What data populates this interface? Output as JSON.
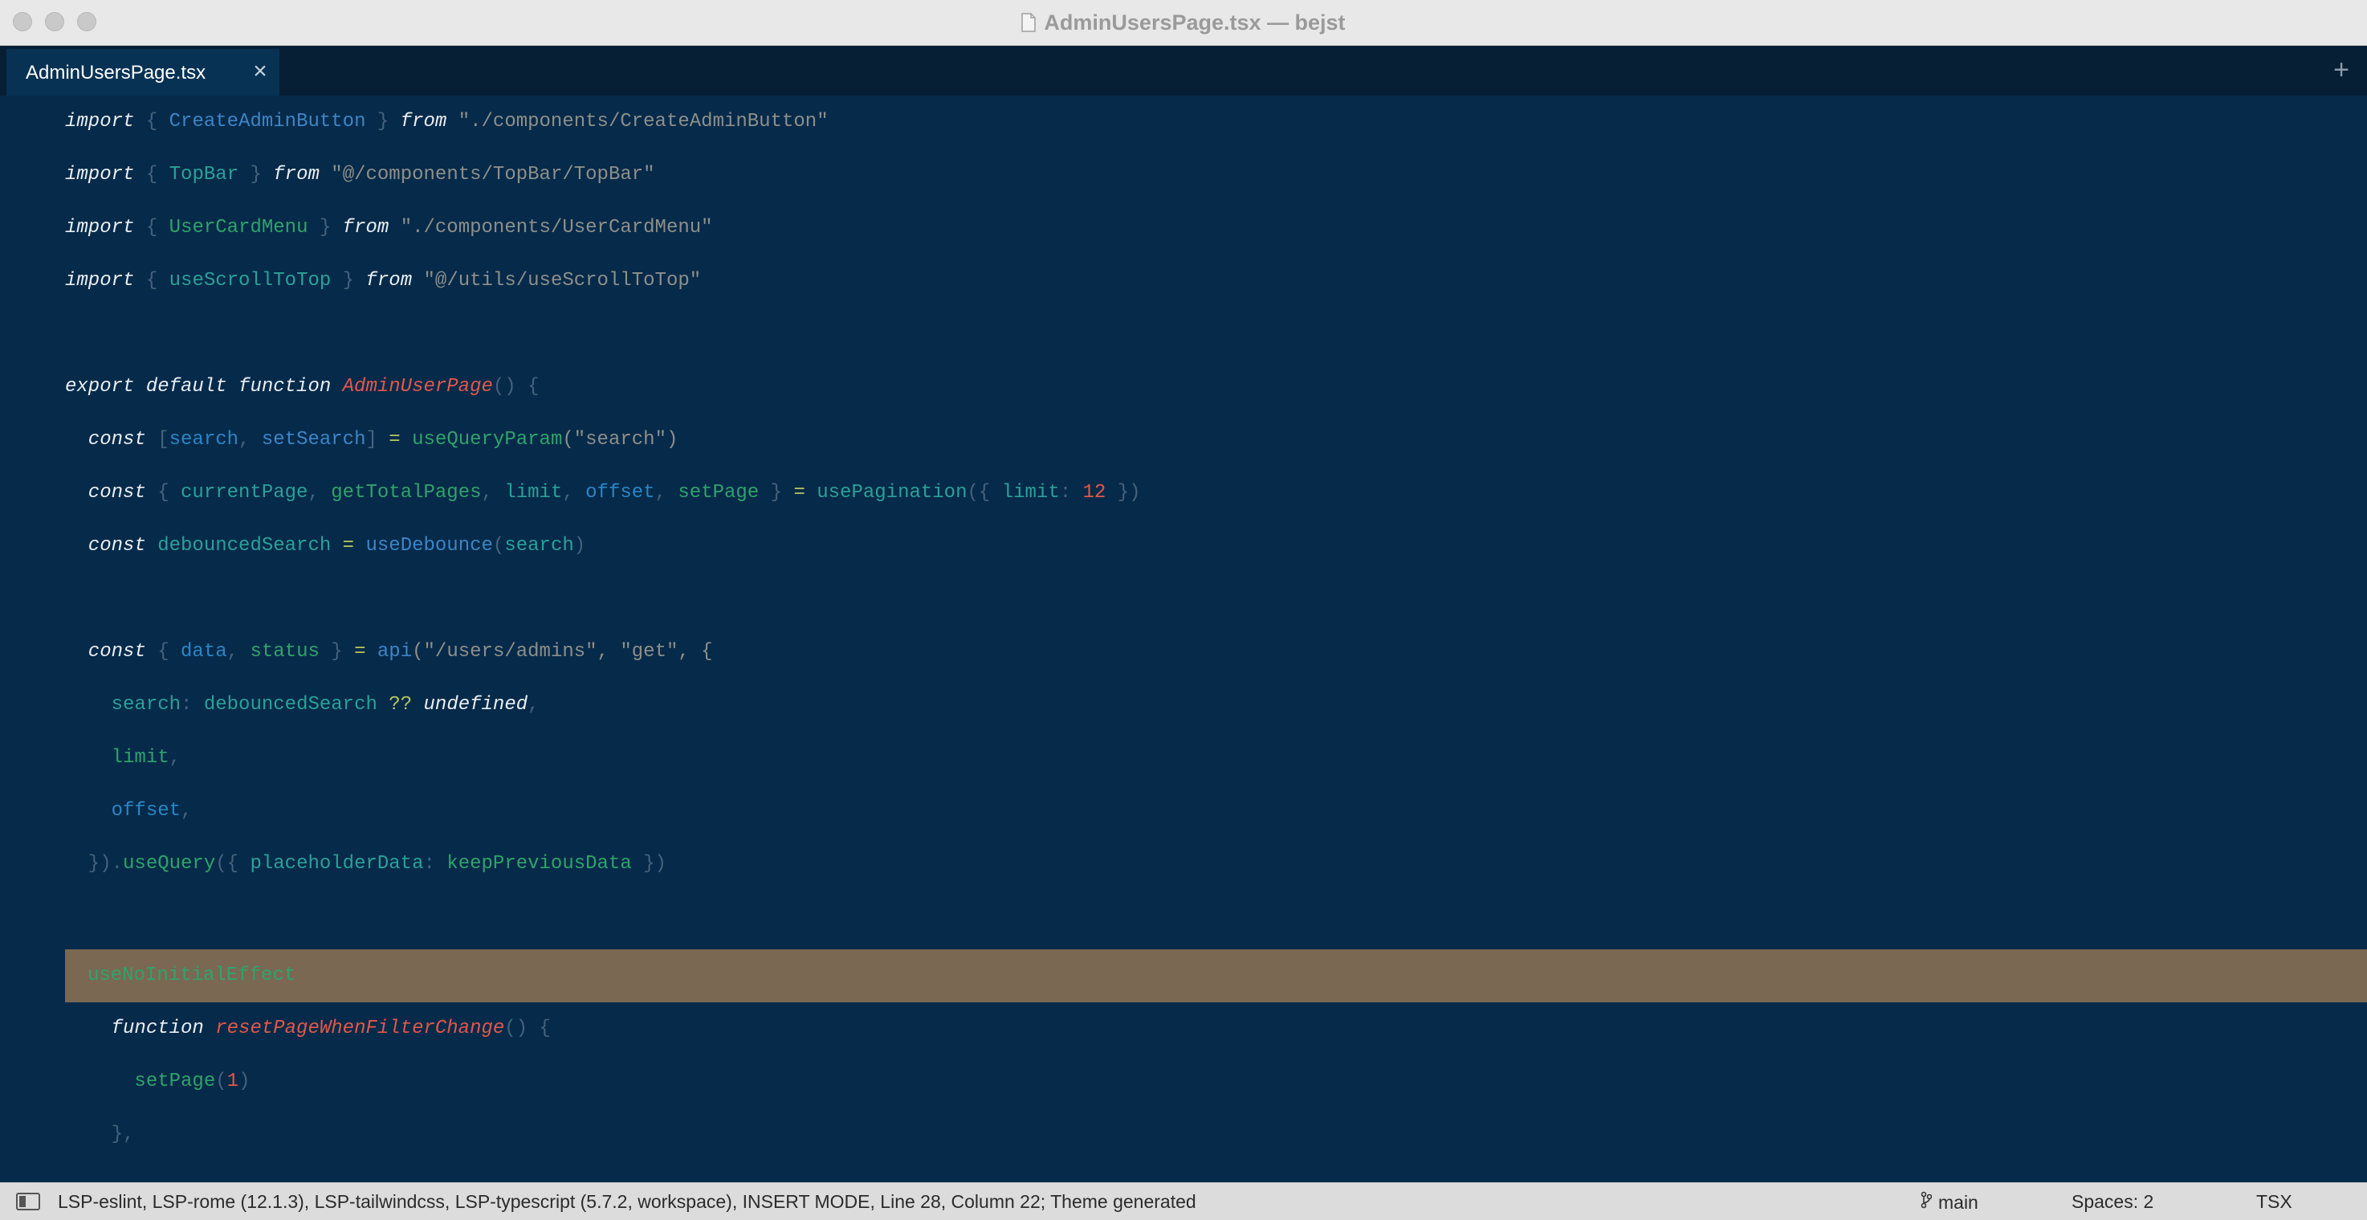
{
  "window": {
    "title": "AdminUsersPage.tsx — bejst"
  },
  "tabs": [
    {
      "label": "AdminUsersPage.tsx",
      "close": "×"
    }
  ],
  "new_tab": "+",
  "code": {
    "l1": {
      "a": "import",
      "b": " { ",
      "c": "CreateAdminButton",
      "d": " } ",
      "e": "from",
      "f": " \"./components/CreateAdminButton\""
    },
    "l2": {
      "a": "import",
      "b": " { ",
      "c": "TopBar",
      "d": " } ",
      "e": "from",
      "f": " \"@/components/TopBar/TopBar\""
    },
    "l3": {
      "a": "import",
      "b": " { ",
      "c": "UserCardMenu",
      "d": " } ",
      "e": "from",
      "f": " \"./components/UserCardMenu\""
    },
    "l4": {
      "a": "import",
      "b": " { ",
      "c": "useScrollToTop",
      "d": " } ",
      "e": "from",
      "f": " \"@/utils/useScrollToTop\""
    },
    "l6": {
      "a": "export default function ",
      "b": "AdminUserPage",
      "c": "() {"
    },
    "l7": {
      "a": "  const ",
      "b": "[",
      "c": "search",
      "d": ", ",
      "e": "setSearch",
      "f": "] ",
      "g": "=",
      "h": " ",
      "i": "useQueryParam",
      "j": "(\"search\")"
    },
    "l8": {
      "a": "  const ",
      "b": "{ ",
      "c": "currentPage",
      "d": ", ",
      "e": "getTotalPages",
      "f": ", ",
      "g": "limit",
      "h": ", ",
      "i": "offset",
      "j": ", ",
      "k": "setPage",
      "l": " } ",
      "m": "=",
      "n": " ",
      "o": "usePagination",
      "p": "({ ",
      "q": "limit",
      "r": ": ",
      "s": "12",
      "t": " })"
    },
    "l9": {
      "a": "  const ",
      "b": "debouncedSearch",
      "c": " ",
      "d": "=",
      "e": " ",
      "f": "useDebounce",
      "g": "(",
      "h": "search",
      "i": ")"
    },
    "l11": {
      "a": "  const ",
      "b": "{ ",
      "c": "data",
      "d": ", ",
      "e": "status",
      "f": " } ",
      "g": "=",
      "h": " ",
      "i": "api",
      "j": "(\"/users/admins\", \"get\", {"
    },
    "l12": {
      "a": "    ",
      "b": "search",
      "c": ": ",
      "d": "debouncedSearch",
      "e": " ",
      "f": "??",
      "g": " ",
      "h": "undefined",
      "i": ","
    },
    "l13": {
      "a": "    ",
      "b": "limit",
      "c": ","
    },
    "l14": {
      "a": "    ",
      "b": "offset",
      "c": ","
    },
    "l15": {
      "a": "  }).",
      "b": "useQuery",
      "c": "({ ",
      "d": "placeholderData",
      "e": ": ",
      "f": "keepPreviousData",
      "g": " })"
    },
    "l17": {
      "a": "useNoInitialEffect"
    },
    "l18": {
      "a": "    function ",
      "b": "resetPageWhenFilterChange",
      "c": "() {"
    },
    "l19": {
      "a": "      ",
      "b": "setPage",
      "c": "(",
      "d": "1",
      "e": ")"
    },
    "l20": {
      "a": "    },"
    }
  },
  "status": {
    "text": "LSP-eslint, LSP-rome (12.1.3), LSP-tailwindcss, LSP-typescript (5.7.2, workspace), INSERT MODE, Line 28, Column 22; Theme generated",
    "branch": "main",
    "spaces": "Spaces: 2",
    "syntax": "TSX"
  }
}
